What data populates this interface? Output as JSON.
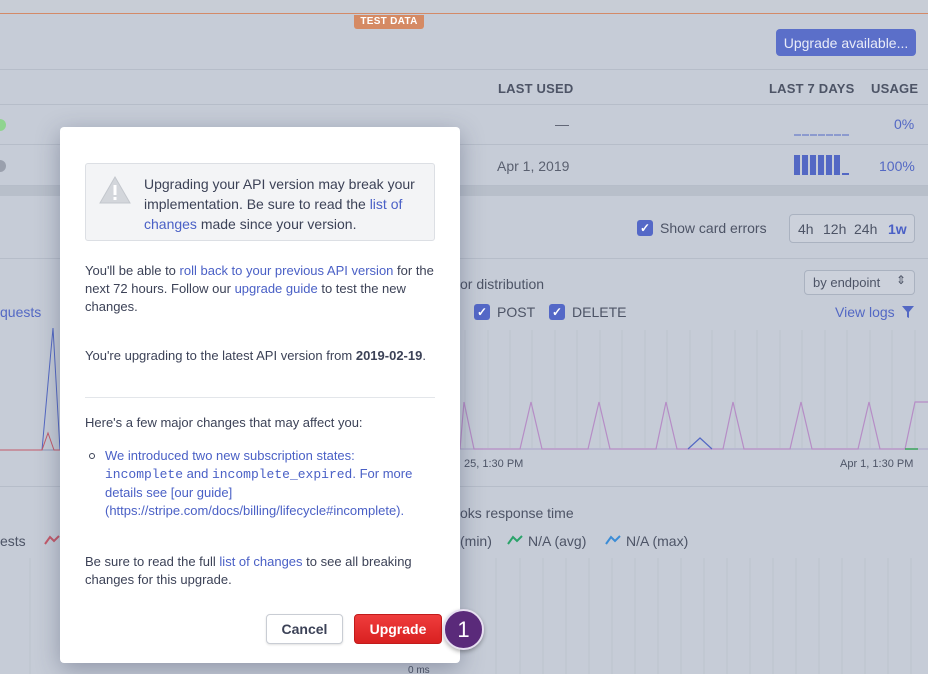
{
  "badge": {
    "test_data": "TEST DATA"
  },
  "header": {
    "upgrade_available": "Upgrade available..."
  },
  "table": {
    "columns": {
      "last_used": "LAST USED",
      "last_7_days": "LAST 7 DAYS",
      "usage": "USAGE"
    },
    "rows": [
      {
        "last_used": "—",
        "usage": "0%",
        "status_color": "#6fcf6f"
      },
      {
        "last_used": "Apr 1, 2019",
        "usage": "100%",
        "status_color": "#9aa0ad"
      }
    ]
  },
  "controls": {
    "show_card_errors": "Show card errors",
    "ranges": [
      "4h",
      "12h",
      "24h",
      "1w"
    ],
    "active_range": "1w"
  },
  "panels": {
    "distribution_title": "or distribution",
    "by_endpoint": "by endpoint",
    "requests_label": "quests",
    "post": "POST",
    "delete": "DELETE",
    "view_logs": "View logs",
    "x_label_left": "25, 1:30 PM",
    "x_label_right": "Apr 1, 1:30 PM",
    "webhooks_title": "oks response time",
    "legend_min": "(min)",
    "legend_avg": "N/A (avg)",
    "legend_max": "N/A (max)",
    "requests_label_2": "ests",
    "zero_ms": "0 ms"
  },
  "modal": {
    "warning": {
      "text_1": "Upgrading your API version may break your implementation. Be sure to read the ",
      "link": "list of changes",
      "text_2": " made since your version."
    },
    "rollback": {
      "text_1": "You'll be able to ",
      "link_1": "roll back to your previous API version",
      "text_2": " for the next 72 hours. Follow our ",
      "link_2": "upgrade guide",
      "text_3": " to test the new changes."
    },
    "upgrading": {
      "text_1": "You're upgrading to the latest API version from ",
      "version": "2019-02-19",
      "text_2": "."
    },
    "major_changes": "Here's a few major changes that may affect you:",
    "bullet": {
      "text_1": "We introduced two new subscription states: ",
      "code_1": "incomplete",
      "text_2": " and ",
      "code_2": "incomplete_expired",
      "text_3": ". For more details see [our guide](https://stripe.com/docs/billing/lifecycle#incomplete)."
    },
    "footer_note": {
      "text_1": "Be sure to read the full ",
      "link": "list of changes",
      "text_2": " to see all breaking changes for this upgrade."
    },
    "cancel_label": "Cancel",
    "upgrade_label": "Upgrade"
  },
  "step_marker": "1",
  "colors": {
    "accent": "#5469d4",
    "danger": "#e02b2b",
    "step": "#5a2a7a"
  }
}
